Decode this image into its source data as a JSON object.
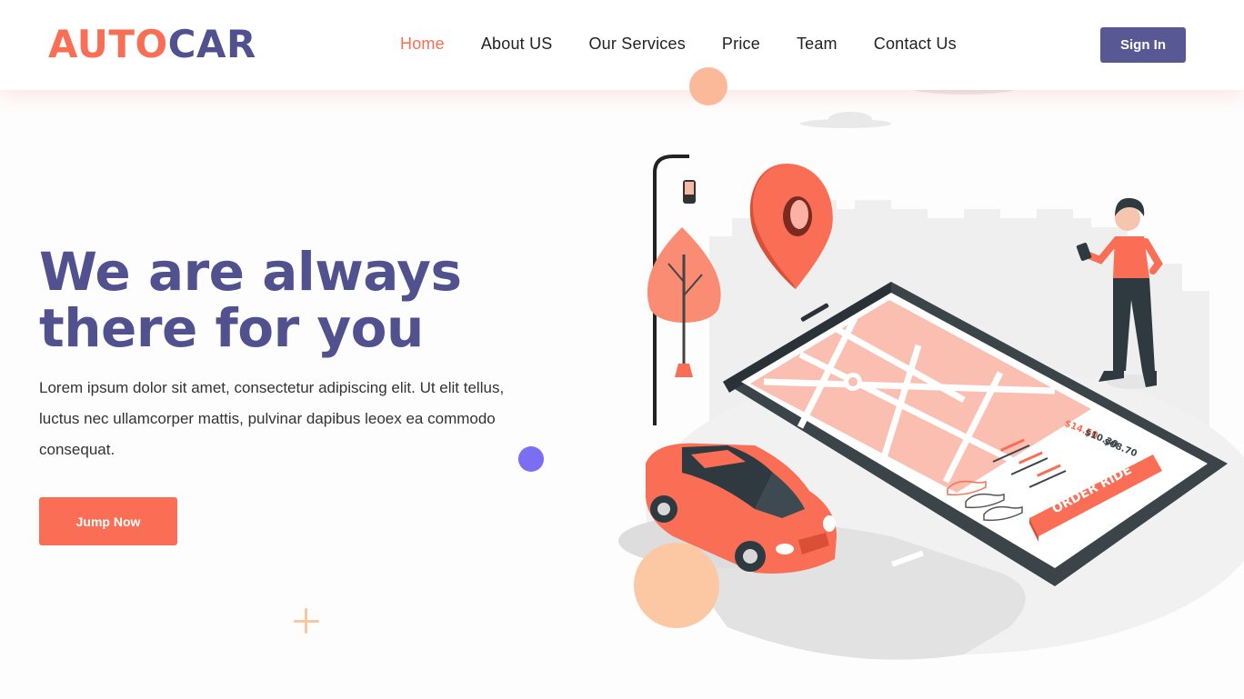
{
  "header": {
    "logo_part1": "AUTO",
    "logo_part2": "CAR",
    "nav": [
      {
        "label": "Home",
        "active": true
      },
      {
        "label": "About US",
        "active": false
      },
      {
        "label": "Our Services",
        "active": false
      },
      {
        "label": "Price",
        "active": false
      },
      {
        "label": "Team",
        "active": false
      },
      {
        "label": "Contact Us",
        "active": false
      }
    ],
    "signin_label": "Sign In"
  },
  "hero": {
    "title_line1": "We are always",
    "title_line2": "there for you",
    "description": "Lorem ipsum dolor sit amet, consectetur adipiscing elit. Ut elit tellus, luctus nec ullamcorper mattis, pulvinar dapibus leoex ea commodo consequat.",
    "cta_label": "Jump Now"
  },
  "illustration": {
    "prices": [
      "$14.50",
      "$10.30",
      "$08.70"
    ],
    "order_button": "ORDER RIDE"
  },
  "colors": {
    "accent": "#fa6e56",
    "brand": "#515190",
    "button": "#575894",
    "dot_blue": "#7b6ef2",
    "peach": "#fbc8a3"
  }
}
